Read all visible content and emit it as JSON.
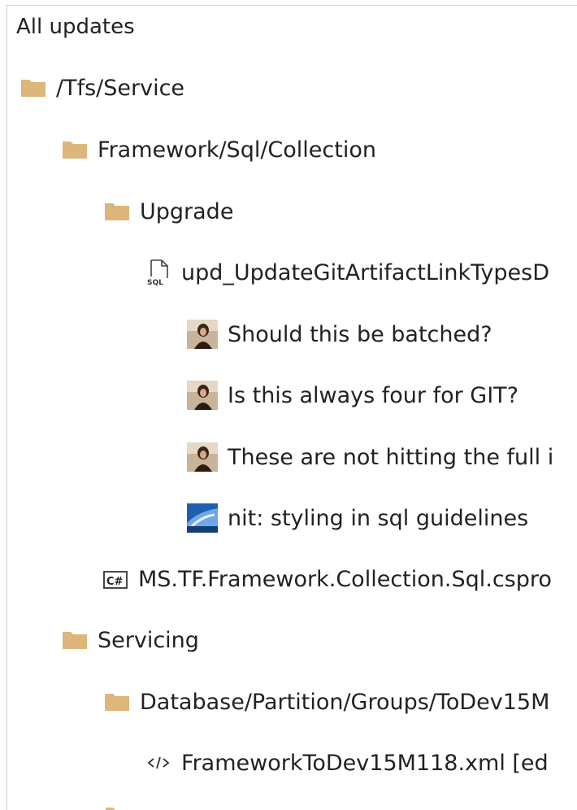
{
  "header": {
    "title": "All updates"
  },
  "tree": {
    "root_folder": "/Tfs/Service",
    "folder_framework": "Framework/Sql/Collection",
    "folder_upgrade": "Upgrade",
    "file_sql": {
      "name": "upd_UpdateGitArtifactLinkTypesD",
      "icon": "sql-file-icon"
    },
    "comments": [
      {
        "text": "Should this be batched?",
        "icon": "user-avatar-icon"
      },
      {
        "text": "Is this always four for GIT?",
        "icon": "user-avatar-icon"
      },
      {
        "text": "These are not hitting the full i",
        "icon": "user-avatar-icon"
      },
      {
        "text": "nit: styling in sql guidelines",
        "icon": "user-avatar-icon"
      }
    ],
    "file_csproj": {
      "name": "MS.TF.Framework.Collection.Sql.cspro",
      "icon": "csharp-file-icon"
    },
    "folder_servicing": "Servicing",
    "folder_database": "Database/Partition/Groups/ToDev15M",
    "file_xml": {
      "name": "FrameworkToDev15M118.xml [ed",
      "icon": "xml-file-icon"
    }
  },
  "colors": {
    "folder": "#dcb67a",
    "text": "#222222",
    "border": "#cfcfcf"
  }
}
